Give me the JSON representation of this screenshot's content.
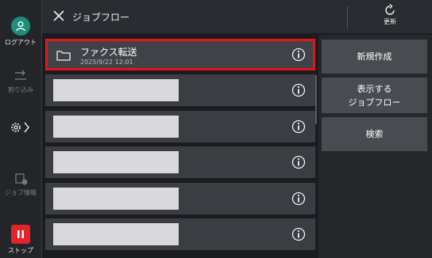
{
  "header": {
    "title": "ジョブフロー",
    "refresh_label": "更新"
  },
  "sidebar": {
    "logout_label": "ログアウト",
    "interrupt_label": "割り込み",
    "job_status_label": "ジョブ情報",
    "stop_label": "ストップ"
  },
  "list": {
    "selected": {
      "name": "ファクス転送",
      "date": "2025/9/22  12:01"
    }
  },
  "actions": {
    "new_label": "新規作成",
    "show_line1": "表示する",
    "show_line2": "ジョブフロー",
    "search_label": "検索"
  },
  "colors": {
    "selection_border": "#e0161b",
    "logout_accent": "#1a8f7e",
    "stop_accent": "#e5232b"
  }
}
